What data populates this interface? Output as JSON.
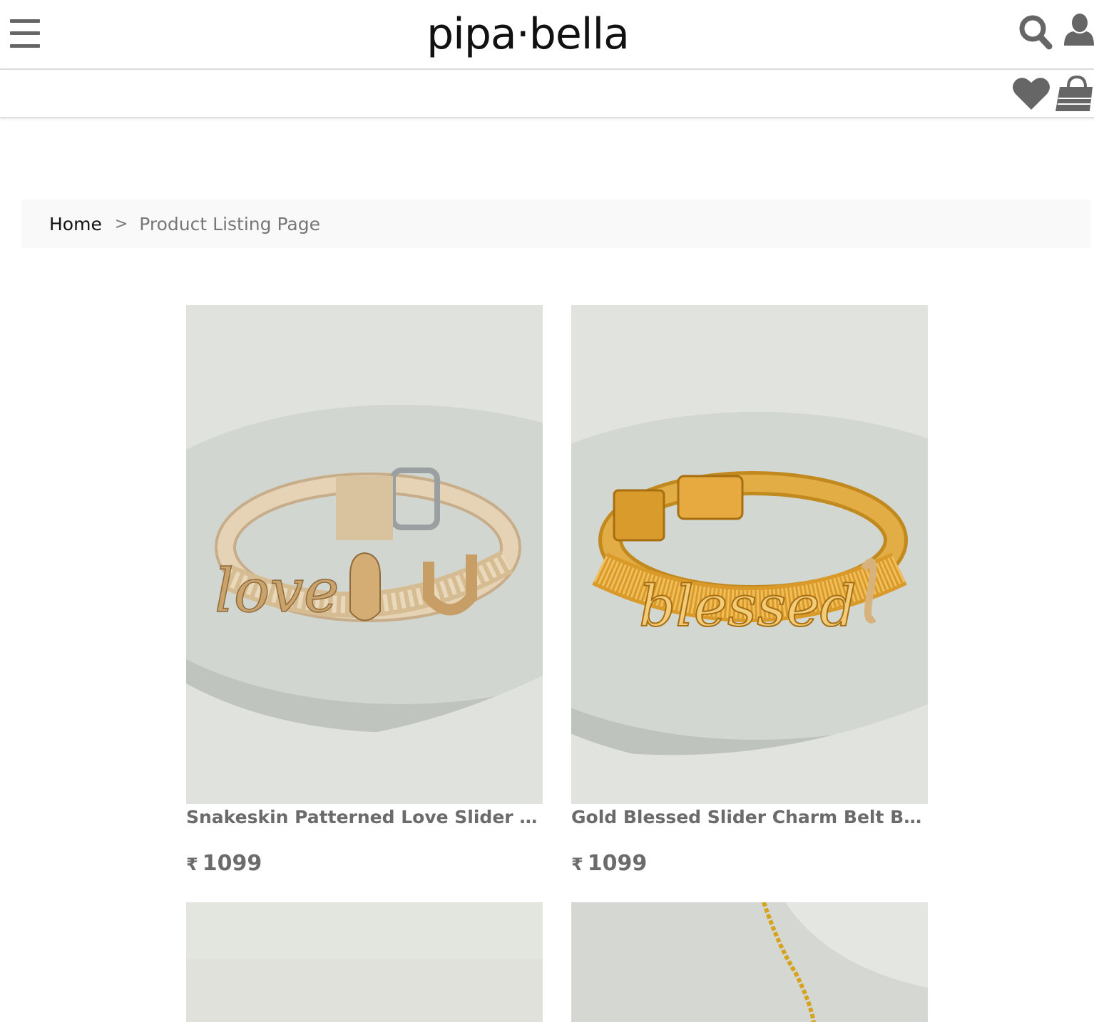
{
  "header": {
    "logo_text": "pipa·bella",
    "icons": [
      "menu-icon",
      "search-icon",
      "user-icon",
      "heart-icon",
      "shopping-bag-icon"
    ]
  },
  "breadcrumb": {
    "home": "Home",
    "separator": ">",
    "current": "Product Listing Page"
  },
  "products": [
    {
      "title": "Snakeskin Patterned Love Slider Charm Belt Bracelet",
      "currency": "₹",
      "price": "1099",
      "charm_text": "love"
    },
    {
      "title": "Gold Blessed Slider Charm Belt Bracelet",
      "currency": "₹",
      "price": "1099",
      "charm_text": "blessed"
    }
  ],
  "colors": {
    "icon_gray": "#666666",
    "text_gray": "#6b6b6b",
    "breadcrumb_bg": "#f9f9f9",
    "product_bg": "#dfe1dc"
  }
}
